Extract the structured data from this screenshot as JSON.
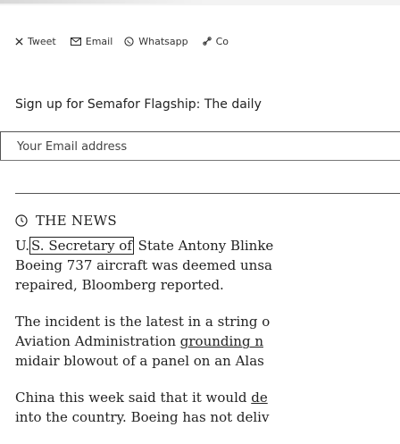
{
  "share": {
    "tweet": "Tweet",
    "email": "Email",
    "whatsapp": "Whatsapp",
    "copy": "Co"
  },
  "signup": {
    "label": "Sign up for Semafor Flagship: The daily",
    "email_placeholder": "Your Email address"
  },
  "news": {
    "title": "THE NEWS"
  },
  "article": {
    "p1": {
      "a": "U.",
      "highlight": "S. Secretary of",
      "b": " State Antony Blinke",
      "line2": "Boeing 737 aircraft was deemed unsa",
      "line3": "repaired, Bloomberg reported."
    },
    "p2": {
      "line1": "The incident is the latest in a string o",
      "line2a": "Aviation Administration ",
      "line2link": "grounding n",
      "line3": "midair blowout of a panel on an Alas"
    },
    "p3": {
      "line1a": "China this week said that it would ",
      "line1link": "de",
      "line2": "into the country. Boeing has not deliv"
    }
  },
  "colors": {
    "background": "#ffffff",
    "text": "#222222",
    "divider": "#555555"
  }
}
